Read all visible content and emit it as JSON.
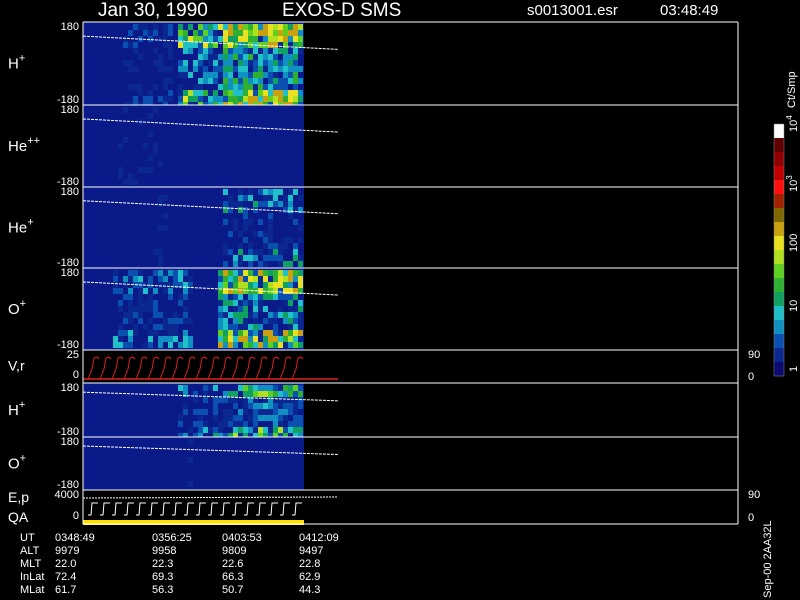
{
  "header": {
    "date": "Jan 30, 1990",
    "instrument": "EXOS-D SMS",
    "file": "s0013001.esr",
    "time": "03:48:49"
  },
  "colorbar": {
    "unit": "Ct/Smp",
    "ticks": [
      {
        "value": 1,
        "label": "1"
      },
      {
        "value": 10,
        "label": "10"
      },
      {
        "value": 100,
        "label": "100"
      },
      {
        "value": 1000,
        "label": "10^3"
      },
      {
        "value": 10000,
        "label": "10^4"
      }
    ],
    "colors": [
      "#0a0a70",
      "#0a2890",
      "#0a50b0",
      "#1090c0",
      "#20c0c8",
      "#10a060",
      "#30b030",
      "#60d020",
      "#b0e020",
      "#e8e020",
      "#c8a010",
      "#806800",
      "#a02000",
      "#ff1010",
      "#c00000",
      "#900000",
      "#600000",
      "#ffffff"
    ]
  },
  "footer": {
    "rows": [
      {
        "label": "UT",
        "values": [
          "0348:49",
          "0356:25",
          "0403:53",
          "0412:09"
        ]
      },
      {
        "label": "ALT",
        "values": [
          "9979",
          "9958",
          "9809",
          "9497"
        ]
      },
      {
        "label": "MLT",
        "values": [
          "22.0",
          "22.3",
          "22.6",
          "22.8"
        ]
      },
      {
        "label": "InLat",
        "values": [
          "72.4",
          "69.3",
          "66.3",
          "62.9"
        ]
      },
      {
        "label": "MLat",
        "values": [
          "61.7",
          "56.3",
          "50.7",
          "44.3"
        ]
      }
    ],
    "side_note": "Sep-00  2AA32L"
  },
  "chart_data": [
    {
      "type": "heatmap",
      "species": "H",
      "charge": "+",
      "ylabel": "H+",
      "ylim": [
        -180,
        180
      ],
      "ticks": [
        "180",
        "-180"
      ],
      "data_end_ut": "0412:09"
    },
    {
      "type": "heatmap",
      "species": "He",
      "charge": "++",
      "ylabel": "He++",
      "ylim": [
        -180,
        180
      ],
      "ticks": [
        "180",
        "-180"
      ]
    },
    {
      "type": "heatmap",
      "species": "He",
      "charge": "+",
      "ylabel": "He+",
      "ylim": [
        -180,
        180
      ],
      "ticks": [
        "180",
        "-180"
      ]
    },
    {
      "type": "heatmap",
      "species": "O",
      "charge": "+",
      "ylabel": "O+",
      "ylim": [
        -180,
        180
      ],
      "ticks": [
        "180",
        "-180"
      ]
    },
    {
      "type": "line",
      "ylabel": "V,r",
      "left_ticks": [
        "25",
        "0"
      ],
      "right_ticks": [
        "90",
        "0"
      ],
      "series_color": "#e02020"
    },
    {
      "type": "heatmap",
      "species": "H",
      "charge": "+",
      "ylabel": "H+",
      "ylim": [
        -180,
        180
      ],
      "ticks": [
        "180",
        "-180"
      ]
    },
    {
      "type": "heatmap",
      "species": "O",
      "charge": "+",
      "ylabel": "O+",
      "ylim": [
        -180,
        180
      ],
      "ticks": [
        "180",
        "-180"
      ]
    },
    {
      "type": "line",
      "ylabel": "E,p",
      "ylabel2": "QA",
      "left_ticks": [
        "4000",
        "0"
      ],
      "right_ticks": [
        "90",
        "0"
      ],
      "qa_color": "#ffe000"
    }
  ]
}
